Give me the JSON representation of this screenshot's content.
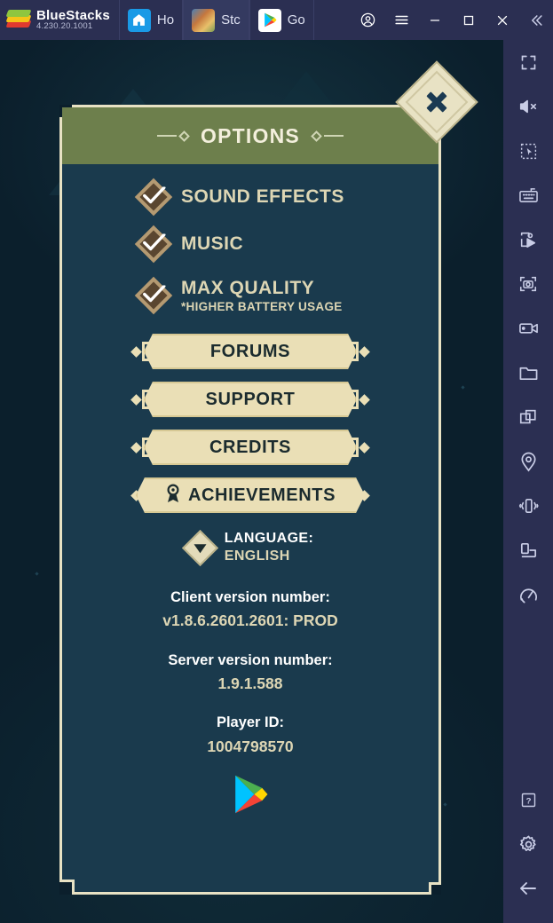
{
  "titlebar": {
    "brand_name": "BlueStacks",
    "brand_version": "4.230.20.1001",
    "logo_icon": "bluestacks-logo-icon",
    "tabs": [
      {
        "label": "Ho",
        "icon": "home-icon"
      },
      {
        "label": "Stc",
        "icon": "game-thumbnail-icon"
      },
      {
        "label": "Go",
        "icon": "google-play-icon"
      }
    ],
    "controls": [
      {
        "name": "account-button",
        "icon": "account-circle-icon"
      },
      {
        "name": "menu-button",
        "icon": "hamburger-menu-icon"
      },
      {
        "name": "minimize-button",
        "icon": "minimize-icon"
      },
      {
        "name": "maximize-button",
        "icon": "maximize-icon"
      },
      {
        "name": "close-button",
        "icon": "close-icon"
      },
      {
        "name": "collapse-button",
        "icon": "double-chevron-left-icon"
      }
    ]
  },
  "sidebar": {
    "items": [
      {
        "name": "fullscreen-button",
        "icon": "fullscreen-icon"
      },
      {
        "name": "mute-button",
        "icon": "speaker-mute-icon"
      },
      {
        "name": "multi-select-button",
        "icon": "cursor-select-icon"
      },
      {
        "name": "keyboard-controls-button",
        "icon": "keyboard-icon"
      },
      {
        "name": "macro-recorder-button",
        "icon": "script-play-icon"
      },
      {
        "name": "screenshot-button",
        "icon": "camera-focus-icon"
      },
      {
        "name": "video-record-button",
        "icon": "video-camera-icon"
      },
      {
        "name": "media-manager-button",
        "icon": "folder-icon"
      },
      {
        "name": "multi-instance-button",
        "icon": "copy-windows-icon"
      },
      {
        "name": "location-button",
        "icon": "location-pin-icon"
      },
      {
        "name": "shake-button",
        "icon": "shake-device-icon"
      },
      {
        "name": "rotate-button",
        "icon": "rotate-screen-icon"
      },
      {
        "name": "performance-button",
        "icon": "gauge-icon"
      }
    ],
    "bottom_items": [
      {
        "name": "help-button",
        "icon": "question-mark-icon"
      },
      {
        "name": "settings-button",
        "icon": "gear-icon"
      },
      {
        "name": "back-button",
        "icon": "arrow-left-icon"
      }
    ]
  },
  "options_panel": {
    "title": "OPTIONS",
    "close_icon": "close-diamond-icon",
    "checkboxes": [
      {
        "label": "SOUND EFFECTS",
        "checked": true,
        "sub": ""
      },
      {
        "label": "MUSIC",
        "checked": true,
        "sub": ""
      },
      {
        "label": "MAX QUALITY",
        "checked": true,
        "sub": "*HIGHER BATTERY USAGE"
      }
    ],
    "buttons": [
      {
        "label": "FORUMS",
        "icon": ""
      },
      {
        "label": "SUPPORT",
        "icon": ""
      },
      {
        "label": "CREDITS",
        "icon": ""
      },
      {
        "label": "ACHIEVEMENTS",
        "icon": "award-ribbon-icon"
      }
    ],
    "language": {
      "key": "LANGUAGE:",
      "value": "ENGLISH",
      "dropdown_icon": "triangle-down-icon"
    },
    "info": [
      {
        "key": "Client version number:",
        "value": "v1.8.6.2601.2601: PROD"
      },
      {
        "key": "Server version number:",
        "value": "1.9.1.588"
      },
      {
        "key": "Player ID:",
        "value": "1004798570"
      }
    ],
    "footer_icon": "google-play-logo-icon"
  },
  "colors": {
    "header_green": "#6d7f4c",
    "panel_bg": "#1a3a4d",
    "cream": "#e8e2c4",
    "button_tan": "#eadfb6",
    "text_tan": "#ddd6b4",
    "titlebar": "#2b2f52"
  }
}
